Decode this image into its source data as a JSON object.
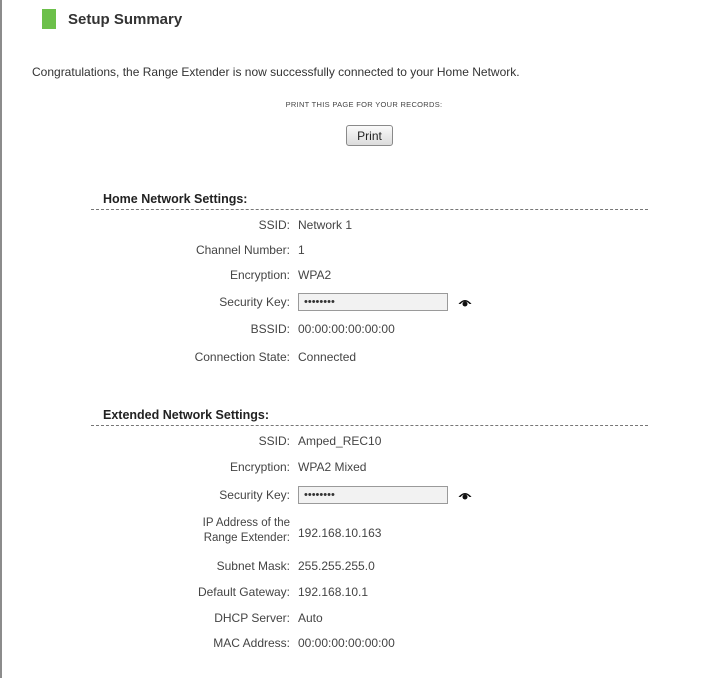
{
  "header": {
    "title": "Setup Summary"
  },
  "intro": "Congratulations, the Range Extender is now successfully connected to your Home Network.",
  "print": {
    "note": "PRINT THIS PAGE FOR YOUR RECORDS:",
    "button_label": "Print"
  },
  "home": {
    "title": "Home Network Settings:",
    "ssid_label": "SSID:",
    "ssid": "Network 1",
    "channel_label": "Channel Number:",
    "channel": "1",
    "encryption_label": "Encryption:",
    "encryption": "WPA2",
    "key_label": "Security Key:",
    "key": "••••••••",
    "bssid_label": "BSSID:",
    "bssid": "00:00:00:00:00:00",
    "state_label": "Connection State:",
    "state": "Connected"
  },
  "extended": {
    "title": "Extended Network Settings:",
    "ssid_label": "SSID:",
    "ssid": "Amped_REC10",
    "encryption_label": "Encryption:",
    "encryption": "WPA2 Mixed",
    "key_label": "Security Key:",
    "key": "••••••••",
    "ip_label_1": "IP Address of the",
    "ip_label_2": "Range Extender:",
    "ip": "192.168.10.163",
    "subnet_label": "Subnet Mask:",
    "subnet": "255.255.255.0",
    "gateway_label": "Default Gateway:",
    "gateway": "192.168.10.1",
    "dhcp_label": "DHCP Server:",
    "dhcp": "Auto",
    "mac_label": "MAC Address:",
    "mac": "00:00:00:00:00:00"
  },
  "colors": {
    "accent": "#6cc04a",
    "text": "#333333",
    "border": "#8c8c8c"
  },
  "icons": {
    "reveal_key": "eye-icon"
  }
}
